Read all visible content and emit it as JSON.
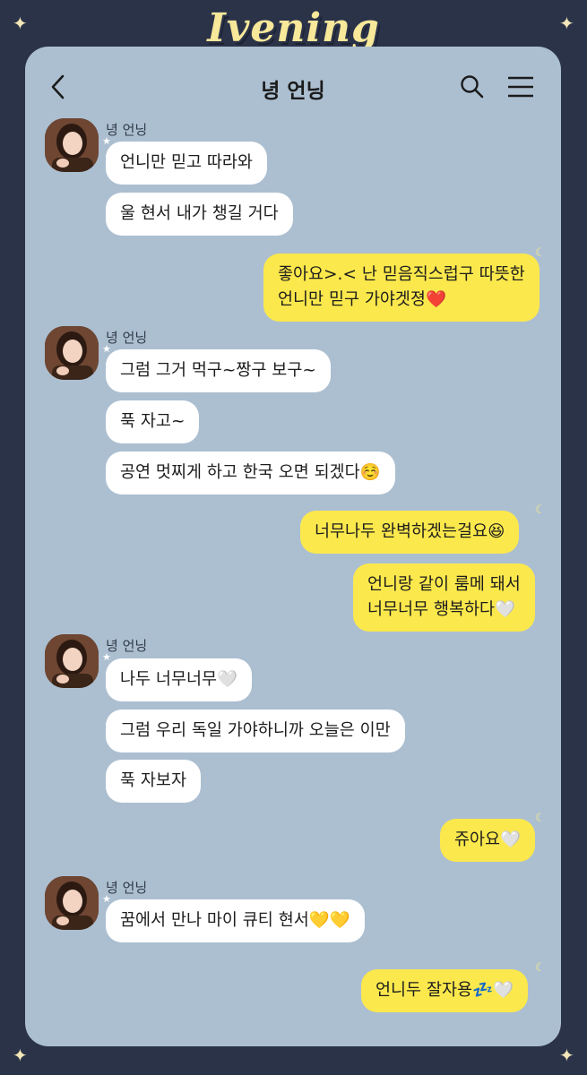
{
  "brand": "Ivening",
  "header": {
    "title": "녕 언닝",
    "back_icon": "chevron-left-icon",
    "search_icon": "search-icon",
    "menu_icon": "hamburger-menu-icon"
  },
  "colors": {
    "background": "#2b3349",
    "panel": "#acbfd1",
    "incoming_bubble": "#ffffff",
    "outgoing_bubble": "#fbe84c"
  },
  "messages": [
    {
      "sender": "녕 언닝",
      "lines": [
        "언니만 믿고 따라와",
        "울 현서 내가 챙길 거다"
      ]
    },
    {
      "outgoing": "좋아요>.< 난 믿음직스럽구 따뜻한\n언니만 믿구 가야겟졍❤️"
    },
    {
      "sender": "녕 언닝",
      "lines": [
        "그럼 그거 먹구~짱구 보구~",
        "푹 자고~",
        "공연 멋찌게 하고 한국 오면 되겠다☺️"
      ]
    },
    {
      "outgoing": "너무나두 완벽하겠는걸요😆"
    },
    {
      "outgoing": "언니랑 같이 룸메 돼서\n너무너무 행복하다🤍"
    },
    {
      "sender": "녕 언닝",
      "lines": [
        "나두 너무너무🤍",
        "그럼 우리 독일 가야하니까 오늘은 이만",
        "푹 자보자"
      ]
    },
    {
      "outgoing": "쥬아요🤍"
    },
    {
      "sender": "녕 언닝",
      "lines": [
        "꿈에서 만나 마이 큐티 현서💛💛"
      ]
    },
    {
      "outgoing": "언니두 잘자용💤🤍"
    }
  ],
  "g1": {
    "sender": "녕 언닝",
    "m1": "언니만 믿고 따라와",
    "m2": "울 현서 내가 챙길 거다"
  },
  "o1": {
    "l1": "좋아요>.< 난 믿음직스럽구 따뜻한",
    "l2": "언니만 믿구 가야겟졍❤️"
  },
  "g2": {
    "sender": "녕 언닝",
    "m1": "그럼 그거 먹구~짱구 보구~",
    "m2": "푹 자고~",
    "m3": "공연 멋찌게 하고 한국 오면 되겠다☺️"
  },
  "o2": {
    "l1": "너무나두 완벽하겠는걸요😆"
  },
  "o3": {
    "l1": "언니랑 같이 룸메 돼서",
    "l2": "너무너무 행복하다🤍"
  },
  "g3": {
    "sender": "녕 언닝",
    "m1": "나두 너무너무🤍",
    "m2": "그럼 우리 독일 가야하니까 오늘은 이만",
    "m3": "푹 자보자"
  },
  "o4": {
    "l1": "쥬아요🤍"
  },
  "g4": {
    "sender": "녕 언닝",
    "m1": "꿈에서 만나 마이 큐티 현서💛💛"
  },
  "o5": {
    "l1": "언니두 잘자용💤🤍"
  }
}
